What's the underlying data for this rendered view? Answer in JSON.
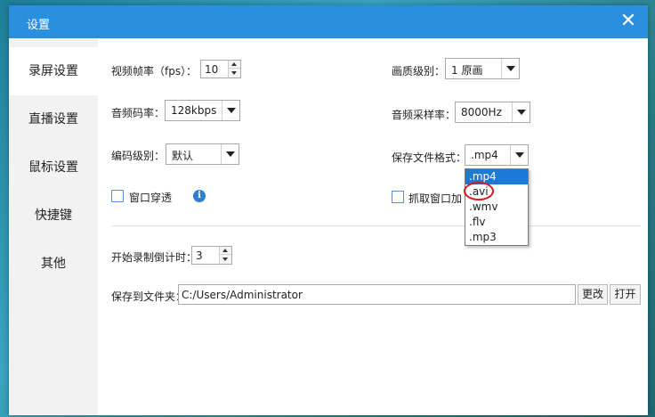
{
  "window": {
    "title": "设置",
    "close_glyph": "✕"
  },
  "sidebar": {
    "items": [
      {
        "label": "录屏设置",
        "active": true
      },
      {
        "label": "直播设置",
        "active": false
      },
      {
        "label": "鼠标设置",
        "active": false
      },
      {
        "label": "快捷键",
        "active": false
      },
      {
        "label": "其他",
        "active": false
      }
    ]
  },
  "form": {
    "fps": {
      "label": "视频帧率（fps）：",
      "value": "10"
    },
    "quality": {
      "label": "画质级别：",
      "value": "1 原画"
    },
    "audio_bitrate": {
      "label": "音频码率：",
      "value": "128kbps"
    },
    "sample_rate": {
      "label": "音频采样率：",
      "value": "8000Hz"
    },
    "encode_level": {
      "label": "编码级别：",
      "value": "默认"
    },
    "file_format": {
      "label": "保存文件格式：",
      "value": ".mp4",
      "options": [
        ".mp4",
        ".avi",
        ".wmv",
        ".flv",
        ".mp3"
      ],
      "selected_index": 0
    },
    "window_through": {
      "label": "窗口穿透",
      "checked": false,
      "info_icon": "info-icon"
    },
    "capture_window": {
      "label": "抓取窗口加",
      "checked": false
    },
    "countdown": {
      "label": "开始录制倒计时：",
      "value": "3"
    },
    "save_folder": {
      "label": "保存到文件夹：",
      "value": "C:/Users/Administrator"
    },
    "change_button": "更改",
    "open_button": "打开"
  },
  "colors": {
    "titlebar": "#2b8fe0",
    "selection": "#1e78d6",
    "annotation": "#e0141b"
  }
}
